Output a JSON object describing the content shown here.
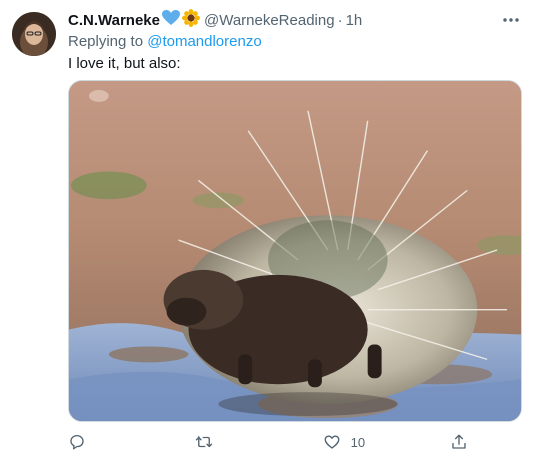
{
  "author": {
    "display_name": "C.N.Warneke",
    "emojis": [
      "blue-heart",
      "sunflower"
    ],
    "handle": "@WarnekeReading",
    "separator": "·",
    "time": "1h"
  },
  "reply": {
    "prefix": "Replying to",
    "mention": "@tomandlorenzo"
  },
  "tweet": {
    "text": "I love it, but also:"
  },
  "media": {
    "icon": "porcupine-photo"
  },
  "actions": {
    "reply_count": "",
    "retweet_count": "",
    "like_count": "10",
    "share_count": ""
  },
  "colors": {
    "accent": "#1d9bf0",
    "secondary_text": "#536471",
    "primary_text": "#0f1419"
  }
}
